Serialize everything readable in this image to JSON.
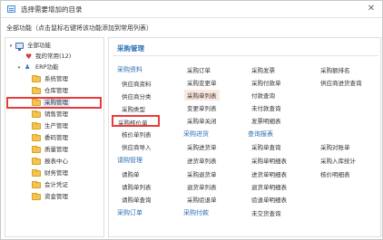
{
  "window": {
    "title": "选择需要增加的目录",
    "close": "✕"
  },
  "hint": "全部功能（点击鼠标右键将该功能添加到常用列表）",
  "tree": {
    "root": "全部功能",
    "favorites": "我的常用(12)",
    "erp": "ERP功能",
    "folders": [
      "系统管理",
      "仓库管理",
      "采购管理",
      "销售管理",
      "生产管理",
      "委码管理",
      "质量管理",
      "报表中心",
      "财务管理",
      "会计凭证",
      "资金管理"
    ],
    "selected_index": 2
  },
  "content": {
    "section": "采购管理",
    "col1": {
      "cat1": "采购资料",
      "items1": [
        "供应商资料",
        "供应商分类",
        "采购类型",
        "采购核价单",
        "核价单列表",
        "供应商导入"
      ],
      "cat2": "请购管理",
      "items2": [
        "请购单",
        "请购单列表",
        "请购单查询"
      ],
      "cat3": "采购订单"
    },
    "col2": {
      "items1": [
        "采购订单",
        "采购变更单",
        "采购单列表",
        "变更单列表",
        "采购单关闭"
      ],
      "cat2": "采购进货",
      "items2": [
        "采购进货单",
        "进货单列表",
        "采购退货单",
        "退货单列表",
        "采购验退单"
      ],
      "cat3": "采购付款"
    },
    "col3": {
      "items1": [
        "采购发票",
        "采购付款单",
        "付款查询",
        "未付款查询",
        "发票明细表"
      ],
      "cat2": "查询报表",
      "items2": [
        "采购单查询",
        "采购单明细表",
        "进货单明细表",
        "退货单明细表",
        "验退单明细表"
      ],
      "item_last": "未交货查询"
    },
    "col4": {
      "items1": [
        "采购额排名",
        "供应商进货查询"
      ],
      "items2": [
        "采购对账单",
        "采购入库统计",
        "核价明细表"
      ]
    }
  }
}
